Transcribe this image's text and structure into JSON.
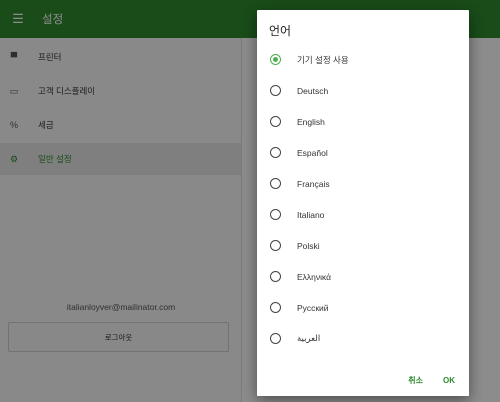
{
  "appbar": {
    "title": "설정",
    "menu_icon": "menu-icon"
  },
  "sidebar": {
    "items": [
      {
        "label": "프린터",
        "icon": "printer-icon"
      },
      {
        "label": "고객 디스플레이",
        "icon": "display-icon"
      },
      {
        "label": "세금",
        "icon": "percent-icon"
      },
      {
        "label": "일반 설정",
        "icon": "gear-icon",
        "active": true
      }
    ],
    "email": "italianloyver@mailinator.com",
    "logout_label": "로그아웃"
  },
  "dialog": {
    "title": "언어",
    "options": [
      {
        "label": "기기 설정 사용",
        "checked": true
      },
      {
        "label": "Deutsch",
        "checked": false
      },
      {
        "label": "English",
        "checked": false
      },
      {
        "label": "Español",
        "checked": false
      },
      {
        "label": "Français",
        "checked": false
      },
      {
        "label": "Italiano",
        "checked": false
      },
      {
        "label": "Polski",
        "checked": false
      },
      {
        "label": "Ελληνικά",
        "checked": false
      },
      {
        "label": "Русский",
        "checked": false
      },
      {
        "label": "العربية",
        "checked": false
      }
    ],
    "cancel_label": "취소",
    "ok_label": "OK"
  },
  "colors": {
    "accent": "#2e8b2e",
    "radio_selected": "#4caf50"
  }
}
